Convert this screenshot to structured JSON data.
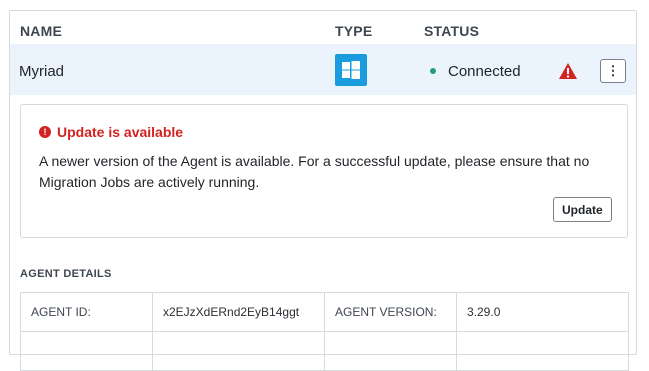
{
  "columns": {
    "name": "NAME",
    "type": "TYPE",
    "status": "STATUS"
  },
  "agent": {
    "name": "Myriad",
    "type_icon": "windows-logo-icon",
    "status": "Connected",
    "status_color": "#1f9e7a",
    "warning_icon": "warning-triangle-icon",
    "more_label": "⋮"
  },
  "update": {
    "title": "Update is available",
    "message": "A newer version of the Agent is available. For a successful update, please ensure that no Migration Jobs are actively running.",
    "button_label": "Update"
  },
  "details": {
    "heading": "AGENT DETAILS",
    "rows": [
      {
        "label1": "AGENT ID:",
        "value1": "x2EJzXdERnd2EyB14ggt",
        "label2": "AGENT VERSION:",
        "value2": "3.29.0"
      },
      {
        "label1": "",
        "value1": "",
        "label2": "",
        "value2": ""
      }
    ]
  },
  "colors": {
    "accent_blue": "#1a9cde",
    "error_red": "#d12320",
    "row_highlight": "#ebf4fc"
  }
}
